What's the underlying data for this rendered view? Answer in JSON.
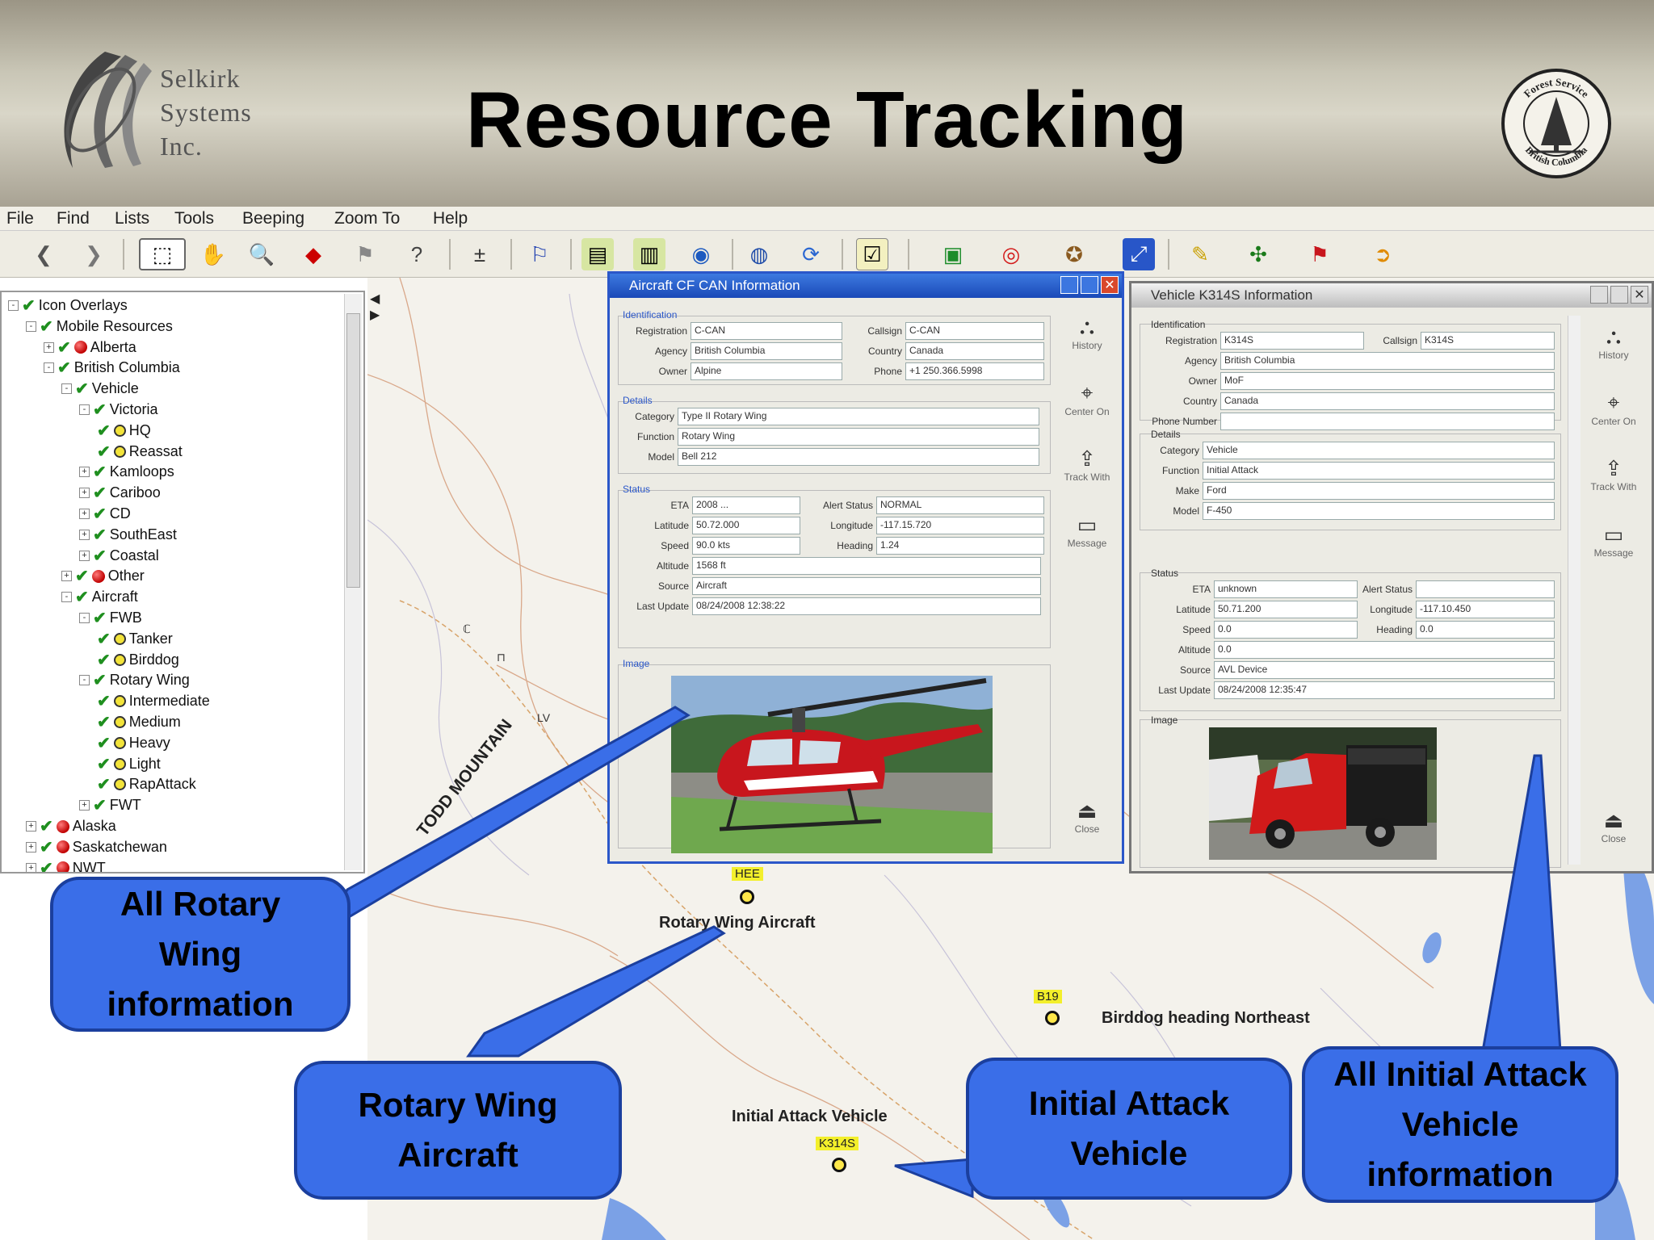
{
  "header": {
    "logo_text": [
      "Selkirk",
      "Systems",
      "Inc."
    ],
    "title": "Resource Tracking",
    "seal_text": [
      "Forest Service",
      "British Columbia"
    ]
  },
  "menu": [
    "File",
    "Find",
    "Lists",
    "Tools",
    "Beeping",
    "Zoom To",
    "Help"
  ],
  "tree": {
    "items": [
      {
        "label": "Icon Overlays",
        "level": 0,
        "exp": "-",
        "icon": "check"
      },
      {
        "label": "Mobile Resources",
        "level": 1,
        "exp": "-",
        "icon": "check"
      },
      {
        "label": "Alberta",
        "level": 2,
        "exp": "+",
        "icon": "red"
      },
      {
        "label": "British Columbia",
        "level": 2,
        "exp": "-",
        "icon": "check"
      },
      {
        "label": "Vehicle",
        "level": 3,
        "exp": "-",
        "icon": "check"
      },
      {
        "label": "Victoria",
        "level": 4,
        "exp": "-",
        "icon": "check"
      },
      {
        "label": "HQ",
        "level": 5,
        "exp": "",
        "icon": "checkdot"
      },
      {
        "label": "Reassat",
        "level": 5,
        "exp": "",
        "icon": "checkdot"
      },
      {
        "label": "Kamloops",
        "level": 4,
        "exp": "+",
        "icon": "check"
      },
      {
        "label": "Cariboo",
        "level": 4,
        "exp": "+",
        "icon": "check"
      },
      {
        "label": "CD",
        "level": 4,
        "exp": "+",
        "icon": "check"
      },
      {
        "label": "SouthEast",
        "level": 4,
        "exp": "+",
        "icon": "check"
      },
      {
        "label": "Coastal",
        "level": 4,
        "exp": "+",
        "icon": "check"
      },
      {
        "label": "Other",
        "level": 3,
        "exp": "+",
        "icon": "red"
      },
      {
        "label": "Aircraft",
        "level": 3,
        "exp": "-",
        "icon": "check"
      },
      {
        "label": "FWB",
        "level": 4,
        "exp": "-",
        "icon": "check"
      },
      {
        "label": "Tanker",
        "level": 5,
        "exp": "",
        "icon": "checkdot"
      },
      {
        "label": "Birddog",
        "level": 5,
        "exp": "",
        "icon": "checkdot"
      },
      {
        "label": "Rotary Wing",
        "level": 4,
        "exp": "-",
        "icon": "check"
      },
      {
        "label": "Intermediate",
        "level": 5,
        "exp": "",
        "icon": "checkdot"
      },
      {
        "label": "Medium",
        "level": 5,
        "exp": "",
        "icon": "checkdot"
      },
      {
        "label": "Heavy",
        "level": 5,
        "exp": "",
        "icon": "checkdot"
      },
      {
        "label": "Light",
        "level": 5,
        "exp": "",
        "icon": "checkdot"
      },
      {
        "label": "RapAttack",
        "level": 5,
        "exp": "",
        "icon": "checkdot"
      },
      {
        "label": "FWT",
        "level": 4,
        "exp": "+",
        "icon": "check"
      },
      {
        "label": "Alaska",
        "level": 1,
        "exp": "+",
        "icon": "red"
      },
      {
        "label": "Saskatchewan",
        "level": 1,
        "exp": "+",
        "icon": "red"
      },
      {
        "label": "NWT",
        "level": 1,
        "exp": "+",
        "icon": "red"
      }
    ]
  },
  "aircraft_window": {
    "title": "Aircraft CF CAN Information",
    "identification_label": "Identification",
    "details_label": "Details",
    "status_label": "Status",
    "image_label": "Image",
    "rows": [
      {
        "label": "Registration",
        "value": "C-CAN",
        "label2": "Callsign",
        "value2": "C-CAN"
      },
      {
        "label": "Agency",
        "value": "British Columbia",
        "label2": "Country",
        "value2": "Canada"
      },
      {
        "label": "Owner",
        "value": "Alpine",
        "label2": "Phone",
        "value2": "+1 250.366.5998"
      }
    ],
    "details": [
      {
        "label": "Category",
        "value": "Type II Rotary Wing"
      },
      {
        "label": "Function",
        "value": "Rotary Wing"
      },
      {
        "label": "Model",
        "value": "Bell 212"
      }
    ],
    "status": [
      {
        "label": "ETA",
        "value": "2008 ..."
      },
      {
        "label": "Latitude",
        "value": "50.72.000"
      },
      {
        "label": "Speed",
        "value": "90.0 kts"
      },
      {
        "label": "Altitude",
        "value": "1568 ft"
      },
      {
        "label": "Source",
        "value": "Aircraft"
      },
      {
        "label": "Last Update",
        "value": "08/24/2008 12:38:22"
      }
    ],
    "status_right": [
      {
        "label": "Alert Status",
        "value": "NORMAL"
      },
      {
        "label": "Longitude",
        "value": "-117.15.720"
      },
      {
        "label": "Heading",
        "value": "1.24"
      }
    ],
    "side": [
      "History",
      "Center On",
      "Track With",
      "Message",
      "Close"
    ]
  },
  "vehicle_window": {
    "title": "Vehicle K314S Information",
    "identification_label": "Identification",
    "details_label": "Details",
    "status_label": "Status",
    "image_label": "Image",
    "rows": [
      {
        "label": "Registration",
        "value": "K314S",
        "label2": "Callsign",
        "value2": "K314S"
      },
      {
        "label": "Agency",
        "value": "British Columbia"
      },
      {
        "label": "Owner",
        "value": "MoF"
      },
      {
        "label": "Country",
        "value": "Canada"
      },
      {
        "label": "Phone Number",
        "value": ""
      }
    ],
    "details": [
      {
        "label": "Category",
        "value": "Vehicle"
      },
      {
        "label": "Function",
        "value": "Initial Attack"
      },
      {
        "label": "Make",
        "value": "Ford"
      },
      {
        "label": "Model",
        "value": "F-450"
      }
    ],
    "status": [
      {
        "label": "ETA",
        "value": "unknown"
      },
      {
        "label": "Latitude",
        "value": "50.71.200"
      },
      {
        "label": "Speed",
        "value": "0.0"
      },
      {
        "label": "Altitude",
        "value": "0.0"
      },
      {
        "label": "Source",
        "value": "AVL Device"
      },
      {
        "label": "Last Update",
        "value": "08/24/2008 12:35:47"
      }
    ],
    "status_right": [
      {
        "label": "Alert Status",
        "value": ""
      },
      {
        "label": "Longitude",
        "value": "-117.10.450"
      },
      {
        "label": "Heading",
        "value": "0.0"
      }
    ],
    "side": [
      "History",
      "Center On",
      "Track With",
      "Message",
      "Close"
    ]
  },
  "map": {
    "labels": {
      "todd": "TODD MOUNTAIN",
      "rotary": "Rotary Wing Aircraft",
      "birddog": "Birddog heading Northeast",
      "vehicle": "Initial Attack Vehicle"
    },
    "tags": {
      "heli": "HEE",
      "bird": "B19",
      "veh": "K314S"
    }
  },
  "callouts": {
    "rotary_info": "All Rotary Wing information",
    "rotary_aircraft": "Rotary Wing Aircraft",
    "ia_vehicle": "Initial Attack Vehicle",
    "ia_vehicle_info": "All Initial Attack Vehicle information"
  },
  "colors": {
    "callout": "#3a6ee8",
    "titlebar": "#1a49b8",
    "heli": "#c8161d",
    "truck": "#d11a1a"
  }
}
